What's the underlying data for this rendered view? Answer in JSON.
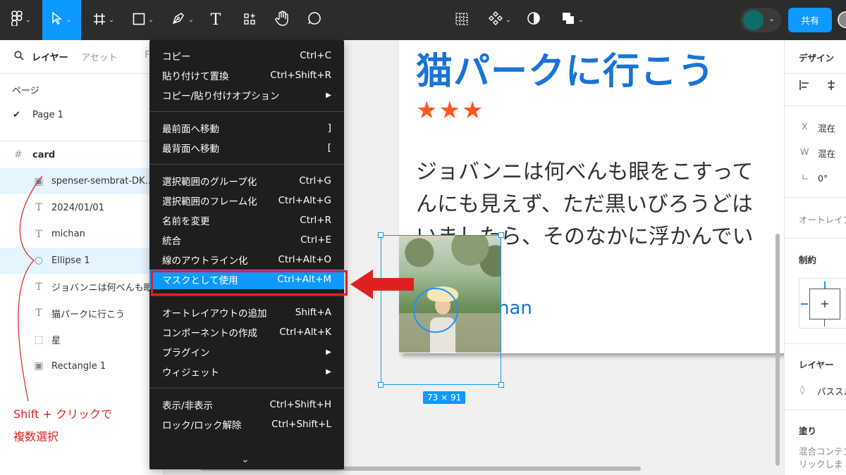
{
  "toolbar": {
    "text_tool_glyph": "T",
    "share_label": "共有"
  },
  "left_panel": {
    "tabs": {
      "layers": "レイヤー",
      "assets": "アセット",
      "extra": "F"
    },
    "pages_heading": "ページ",
    "page": "Page 1",
    "frame": "card",
    "layers": [
      {
        "icon": "image-icon",
        "glyph": "▣",
        "label": "spenser-sembrat-DK...",
        "selected": true
      },
      {
        "icon": "text-icon",
        "glyph": "T",
        "label": "2024/01/01",
        "selected": false
      },
      {
        "icon": "text-icon",
        "glyph": "T",
        "label": "michan",
        "selected": false
      },
      {
        "icon": "ellipse-icon",
        "glyph": "○",
        "label": "Ellipse 1",
        "selected": true
      },
      {
        "icon": "text-icon",
        "glyph": "T",
        "label": "ジョバンニは何べんも眼",
        "selected": false
      },
      {
        "icon": "text-icon",
        "glyph": "T",
        "label": "猫パークに行こう",
        "selected": false
      },
      {
        "icon": "group-icon",
        "glyph": "⬚",
        "label": "星",
        "selected": false
      },
      {
        "icon": "image-icon",
        "glyph": "▣",
        "label": "Rectangle 1",
        "selected": false
      }
    ]
  },
  "context_menu": {
    "items": [
      {
        "label": "コピー",
        "shortcut": "Ctrl+C"
      },
      {
        "label": "貼り付けて置換",
        "shortcut": "Ctrl+Shift+R"
      },
      {
        "label": "コピー/貼り付けオプション",
        "shortcut": "▶"
      },
      {
        "label": "最前面へ移動",
        "shortcut": "]"
      },
      {
        "label": "最背面へ移動",
        "shortcut": "["
      },
      {
        "label": "選択範囲のグループ化",
        "shortcut": "Ctrl+G"
      },
      {
        "label": "選択範囲のフレーム化",
        "shortcut": "Ctrl+Alt+G"
      },
      {
        "label": "名前を変更",
        "shortcut": "Ctrl+R"
      },
      {
        "label": "統合",
        "shortcut": "Ctrl+E"
      },
      {
        "label": "線のアウトライン化",
        "shortcut": "Ctrl+Alt+O"
      },
      {
        "label": "マスクとして使用",
        "shortcut": "Ctrl+Alt+M",
        "highlighted": true
      },
      {
        "label": "オートレイアウトの追加",
        "shortcut": "Shift+A"
      },
      {
        "label": "コンポーネントの作成",
        "shortcut": "Ctrl+Alt+K"
      },
      {
        "label": "プラグイン",
        "shortcut": "▶"
      },
      {
        "label": "ウィジェット",
        "shortcut": "▶"
      },
      {
        "label": "表示/非表示",
        "shortcut": "Ctrl+Shift+H"
      },
      {
        "label": "ロック/ロック解除",
        "shortcut": "Ctrl+Shift+L"
      }
    ],
    "scroll_indicator": "⌄"
  },
  "canvas": {
    "card_title": "猫パークに行こう",
    "stars": "★★★",
    "body_text": "ジョバンニは何べんも眼をこすって\nんにも見えず、ただ黒いびろうどは\nいましたら、そのなかに浮かんでい",
    "author": "han",
    "selection_size": "73 × 91"
  },
  "right_panel": {
    "design_tab": "デザイン",
    "x_label": "X",
    "x_value": "混在",
    "w_label": "W",
    "w_value": "混在",
    "rotation_label": "∟",
    "rotation_value": "0°",
    "auto_layout": "オートレイア",
    "constraints": "制約",
    "layer_heading": "レイヤー",
    "pass_through": "パススル",
    "fill_heading": "塗り",
    "fill_hint_1": "混合コンテン",
    "fill_hint_2": "リックしま"
  },
  "annotation": {
    "text": "Shift + クリックで\n複数選択"
  },
  "colors": {
    "accent": "#0d99ff",
    "annotation_red": "#e02020",
    "title_blue": "#1a73d6",
    "star_orange": "#ff5722"
  }
}
